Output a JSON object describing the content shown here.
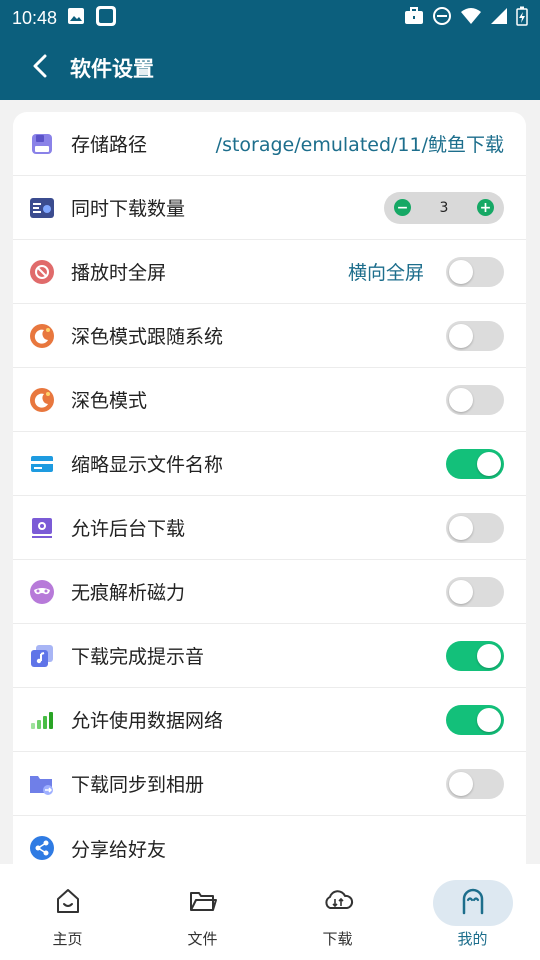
{
  "status_bar": {
    "time": "10:48",
    "left_icons": [
      "image-icon",
      "app-square-icon"
    ],
    "right_icons": [
      "briefcase-icon",
      "do-not-disturb-icon",
      "wifi-icon",
      "signal-icon",
      "battery-charging-icon"
    ]
  },
  "app_bar": {
    "title": "软件设置",
    "back_icon": "back-arrow-icon"
  },
  "settings": {
    "storage_path": {
      "label": "存储路径",
      "value": "/storage/emulated/11/鱿鱼下载",
      "icon": "storage-icon"
    },
    "concurrent_downloads": {
      "label": "同时下载数量",
      "value": "3",
      "minus": "−",
      "plus": "+",
      "icon": "download-count-icon"
    },
    "fullscreen_on_play": {
      "label": "播放时全屏",
      "value": "横向全屏",
      "on": false,
      "icon": "fullscreen-icon"
    },
    "dark_follow_system": {
      "label": "深色模式跟随系统",
      "on": false,
      "icon": "moon-icon"
    },
    "dark_mode": {
      "label": "深色模式",
      "on": false,
      "icon": "moon-icon"
    },
    "abbreviate_filenames": {
      "label": "缩略显示文件名称",
      "on": true,
      "icon": "card-icon"
    },
    "background_download": {
      "label": "允许后台下载",
      "on": false,
      "icon": "background-icon"
    },
    "incognito_magnet": {
      "label": "无痕解析磁力",
      "on": false,
      "icon": "mask-icon"
    },
    "download_complete_sound": {
      "label": "下载完成提示音",
      "on": true,
      "icon": "music-note-icon"
    },
    "allow_mobile_data": {
      "label": "允许使用数据网络",
      "on": true,
      "icon": "signal-bars-icon"
    },
    "sync_to_album": {
      "label": "下载同步到相册",
      "on": false,
      "icon": "folder-share-icon"
    },
    "share": {
      "label": "分享给好友",
      "icon": "share-icon"
    }
  },
  "bottom_nav": {
    "items": [
      {
        "label": "主页",
        "icon": "home-icon",
        "active": false
      },
      {
        "label": "文件",
        "icon": "folder-icon",
        "active": false
      },
      {
        "label": "下载",
        "icon": "cloud-download-icon",
        "active": false
      },
      {
        "label": "我的",
        "icon": "profile-icon",
        "active": true
      }
    ]
  },
  "colors": {
    "primary": "#0c5f7d",
    "accent_text": "#1d6e8c",
    "toggle_on": "#13c07a",
    "toggle_off": "#dcdcdc",
    "stepper_button": "#16a865"
  }
}
